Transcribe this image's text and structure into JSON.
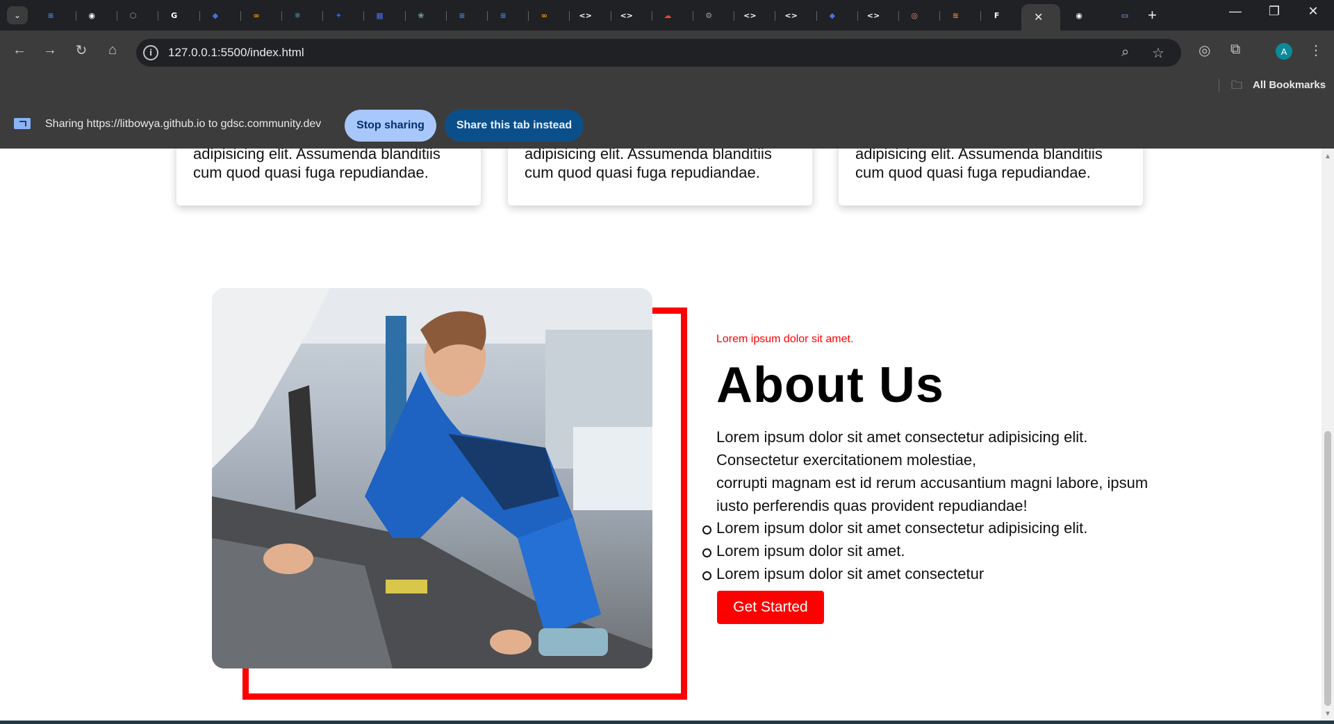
{
  "browser": {
    "tabs": [
      {
        "icon": "docs-icon",
        "color": "#4285f4",
        "glyph": "≡"
      },
      {
        "icon": "github-icon",
        "color": "#ffffff",
        "glyph": "◉"
      },
      {
        "icon": "hexagon-icon",
        "color": "#9aa0a6",
        "glyph": "⬡"
      },
      {
        "icon": "google-icon",
        "color": "#ffffff",
        "glyph": "G"
      },
      {
        "icon": "shield-icon",
        "color": "#4a6ee0",
        "glyph": "◆"
      },
      {
        "icon": "infinity-icon",
        "color": "#f29900",
        "glyph": "∞"
      },
      {
        "icon": "react-icon",
        "color": "#61dafb",
        "glyph": "⚛"
      },
      {
        "icon": "bird-icon",
        "color": "#1a73e8",
        "glyph": "✦"
      },
      {
        "icon": "grid-icon",
        "color": "#4a6ee0",
        "glyph": "▦"
      },
      {
        "icon": "chatgpt-icon",
        "color": "#74aa9c",
        "glyph": "❀"
      },
      {
        "icon": "docs-icon",
        "color": "#4285f4",
        "glyph": "≡"
      },
      {
        "icon": "docs-icon",
        "color": "#4285f4",
        "glyph": "≡"
      },
      {
        "icon": "infinity-icon",
        "color": "#f29900",
        "glyph": "∞"
      },
      {
        "icon": "code-icon",
        "color": "#ffffff",
        "glyph": "<>"
      },
      {
        "icon": "code-icon",
        "color": "#ffffff",
        "glyph": "<>"
      },
      {
        "icon": "cloud-icon",
        "color": "#ea4335",
        "glyph": "☁"
      },
      {
        "icon": "gear-icon",
        "color": "#9aa0a6",
        "glyph": "⚙"
      },
      {
        "icon": "code-icon",
        "color": "#ffffff",
        "glyph": "<>"
      },
      {
        "icon": "code-icon",
        "color": "#ffffff",
        "glyph": "<>"
      },
      {
        "icon": "shield-icon",
        "color": "#4a6ee0",
        "glyph": "◆"
      },
      {
        "icon": "code-icon",
        "color": "#ffffff",
        "glyph": "<>"
      },
      {
        "icon": "record-icon",
        "color": "#f28b82",
        "glyph": "◎"
      },
      {
        "icon": "stackoverflow-icon",
        "color": "#f48024",
        "glyph": "≋"
      },
      {
        "icon": "framer-icon",
        "color": "#ffffff",
        "glyph": "F"
      }
    ],
    "active_tab_close": "✕",
    "after_tabs": [
      {
        "icon": "github-icon",
        "color": "#ffffff",
        "glyph": "◉"
      },
      {
        "icon": "window-icon",
        "color": "#8ab4f8",
        "glyph": "▭"
      }
    ],
    "new_tab": "+",
    "window_controls": {
      "minimize": "—",
      "restore": "❐",
      "close": "✕"
    },
    "url": "127.0.0.1:5500/index.html",
    "bookmarks_label": "All Bookmarks",
    "avatar_letter": "A"
  },
  "sharing": {
    "text": "Sharing https://litbowya.github.io to gdsc.community.dev",
    "stop_label": "Stop sharing",
    "share_tab_label": "Share this tab instead"
  },
  "cards": [
    {
      "text": "adipisicing elit. Assumenda blanditiis cum quod quasi fuga repudiandae."
    },
    {
      "text": "adipisicing elit. Assumenda blanditiis cum quod quasi fuga repudiandae."
    },
    {
      "text": "adipisicing elit. Assumenda blanditiis cum quod quasi fuga repudiandae."
    }
  ],
  "about": {
    "eyebrow": "Lorem ipsum dolor sit amet.",
    "title": "About Us",
    "body_line1": "Lorem ipsum dolor sit amet consectetur adipisicing elit.",
    "body_line2": "Consectetur exercitationem molestiae,",
    "body_line3": "corrupti magnam est id rerum accusantium magni labore, ipsum iusto perferendis quas provident repudiandae!",
    "list": [
      "Lorem ipsum dolor sit amet consectetur adipisicing elit.",
      "Lorem ipsum dolor sit amet.",
      "Lorem ipsum dolor sit amet consectetur"
    ],
    "button": "Get Started",
    "accent_color": "#ff0000"
  }
}
